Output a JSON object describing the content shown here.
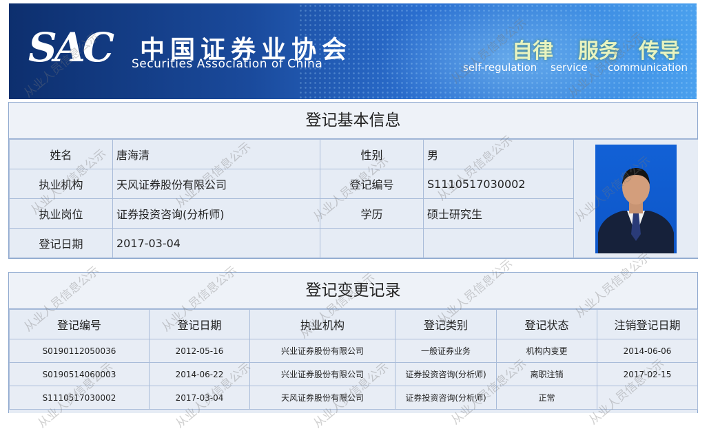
{
  "header": {
    "logo_abbr": "SAC",
    "logo_cn": "中国证券业协会",
    "logo_en": "Securities Association of China",
    "slogans": [
      {
        "cn": "自律",
        "en": "self-regulation"
      },
      {
        "cn": "服务",
        "en": "service"
      },
      {
        "cn": "传导",
        "en": "communication"
      }
    ]
  },
  "basic_info": {
    "title": "登记基本信息",
    "name_label": "姓名",
    "name_value": "唐海清",
    "gender_label": "性别",
    "gender_value": "男",
    "org_label": "执业机构",
    "org_value": "天风证券股份有限公司",
    "reg_no_label": "登记编号",
    "reg_no_value": "S1110517030002",
    "post_label": "执业岗位",
    "post_value": "证券投资咨询(分析师)",
    "edu_label": "学历",
    "edu_value": "硕士研究生",
    "date_label": "登记日期",
    "date_value": "2017-03-04"
  },
  "change_records": {
    "title": "登记变更记录",
    "columns": [
      "登记编号",
      "登记日期",
      "执业机构",
      "登记类别",
      "登记状态",
      "注销登记日期"
    ],
    "rows": [
      [
        "S0190112050036",
        "2012-05-16",
        "兴业证券股份有限公司",
        "一般证券业务",
        "机构内变更",
        "2014-06-06"
      ],
      [
        "S0190514060003",
        "2014-06-22",
        "兴业证券股份有限公司",
        "证券投资咨询(分析师)",
        "离职注销",
        "2017-02-15"
      ],
      [
        "S1110517030002",
        "2017-03-04",
        "天风证券股份有限公司",
        "证券投资咨询(分析师)",
        "正常",
        ""
      ]
    ]
  },
  "watermark": "从业人员信息公示",
  "colors": {
    "banner_dark": "#0d2f6e",
    "banner_light": "#4aa0ee",
    "panel_bg": "#e6ecf5",
    "border": "#8fa9cf"
  }
}
